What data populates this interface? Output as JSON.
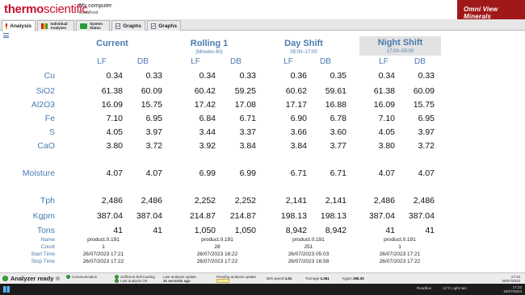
{
  "header": {
    "logo_thermo": "thermo",
    "logo_scientific": "scientific",
    "computer_name": "My computer",
    "host": "Localhost",
    "brand": "Omni View Minerals"
  },
  "tabs": [
    {
      "label": "Analysis",
      "icon": "analysis-icon"
    },
    {
      "label": "Individual Analyzes",
      "icon": "individual-analyzers-icon"
    },
    {
      "label": "System Status",
      "icon": "system-status-icon"
    },
    {
      "label": "Graphs",
      "icon": "graph-icon"
    },
    {
      "label": "Graphs",
      "icon": "graph-icon"
    }
  ],
  "groups": [
    {
      "title": "Current",
      "subtitle": ""
    },
    {
      "title": "Rolling 1",
      "subtitle": "(Minutes 60)"
    },
    {
      "title": "Day Shift",
      "subtitle": "05:00–17:00"
    },
    {
      "title": "Night Shift",
      "subtitle": "17:00–05:00"
    }
  ],
  "columns": [
    "LF",
    "DB"
  ],
  "rows": [
    {
      "label": "Cu",
      "values": [
        "0.34",
        "0.33",
        "0.34",
        "0.33",
        "0.36",
        "0.35",
        "0.34",
        "0.33"
      ]
    },
    {
      "label": "SiO2",
      "values": [
        "61.38",
        "60.09",
        "60.42",
        "59.25",
        "60.62",
        "59.61",
        "61.38",
        "60.09"
      ]
    },
    {
      "label": "Al2O3",
      "values": [
        "16.09",
        "15.75",
        "17.42",
        "17.08",
        "17.17",
        "16.88",
        "16.09",
        "15.75"
      ]
    },
    {
      "label": "Fe",
      "values": [
        "7.10",
        "6.95",
        "6.84",
        "6.71",
        "6.90",
        "6.78",
        "7.10",
        "6.95"
      ]
    },
    {
      "label": "S",
      "values": [
        "4.05",
        "3.97",
        "3.44",
        "3.37",
        "3.66",
        "3.60",
        "4.05",
        "3.97"
      ]
    },
    {
      "label": "CaO",
      "values": [
        "3.80",
        "3.72",
        "3.92",
        "3.84",
        "3.84",
        "3.77",
        "3.80",
        "3.72"
      ]
    },
    {
      "label": "Moisture",
      "values": [
        "4.07",
        "4.07",
        "6.99",
        "6.99",
        "6.71",
        "6.71",
        "4.07",
        "4.07"
      ]
    },
    {
      "label": "Tph",
      "values": [
        "2,486",
        "2,486",
        "2,252",
        "2,252",
        "2,141",
        "2,141",
        "2,486",
        "2,486"
      ]
    },
    {
      "label": "Kgpm",
      "values": [
        "387.04",
        "387.04",
        "214.87",
        "214.87",
        "198.13",
        "198.13",
        "387.04",
        "387.04"
      ]
    },
    {
      "label": "Tons",
      "values": [
        "41",
        "41",
        "1,050",
        "1,050",
        "8,942",
        "8,942",
        "41",
        "41"
      ]
    }
  ],
  "info": [
    {
      "label": "Name",
      "values": [
        "product.0.191",
        "product.0.191",
        "product.0.191",
        "product.0.191"
      ]
    },
    {
      "label": "Count",
      "values": [
        "1",
        "28",
        "251",
        "1"
      ]
    },
    {
      "label": "Start Time",
      "values": [
        "26/07/2023 17:21",
        "26/07/2023 16:22",
        "26/07/2023 05:03",
        "26/07/2023 17:21"
      ]
    },
    {
      "label": "Stop Time",
      "values": [
        "26/07/2023 17:22",
        "26/07/2023 17:22",
        "26/07/2023 16:58",
        "26/07/2023 17:22"
      ]
    }
  ],
  "status": {
    "ready": "Analyzer ready",
    "communication": "Communication",
    "belt_loading": "Sufficient belt loading",
    "last_analysis": "Last analysis OK",
    "last_update_label": "Last analysis update",
    "last_update_value": "31 seconds ago",
    "pending_label": "Pending analysis update",
    "belt_speed_label": "Belt speed",
    "belt_speed_value": "3.31",
    "tonnage_label": "Tonnage",
    "tonnage_value": "2,361",
    "kgpm_label": "Kgpm",
    "kgpm_value": "286.30",
    "time": "17:23",
    "date": "26/07/2023"
  },
  "taskbar": {
    "app": "Readbus",
    "weather": "14°C Light rain",
    "time": "17:23",
    "date": "26/07/2023"
  },
  "colors": {
    "brand_red": "#c8102e",
    "label_blue": "#4a7ab0",
    "shaded_header": "#e2e2e2"
  }
}
